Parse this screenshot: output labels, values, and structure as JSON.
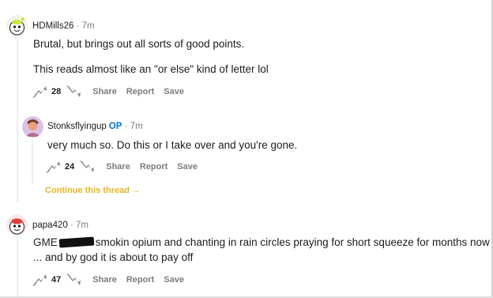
{
  "comments": [
    {
      "author": "HDMills26",
      "op_badge": "",
      "separator": "·",
      "time": "7m",
      "lines": [
        "Brutal, but brings out all sorts of good points.",
        "This reads almost like an \"or else\" kind of letter lol"
      ],
      "score": "28",
      "actions": [
        "Share",
        "Report",
        "Save"
      ]
    },
    {
      "author": "Stonksflyingup",
      "op_badge": "OP",
      "separator": "·",
      "time": "7m",
      "lines": [
        "very much so. Do this or I take over and you're gone."
      ],
      "score": "24",
      "actions": [
        "Share",
        "Report",
        "Save"
      ],
      "continue_link": "Continue this thread →"
    },
    {
      "author": "papa420",
      "op_badge": "",
      "separator": "·",
      "time": "7m",
      "line1_before": "GME",
      "line1_after": "smokin opium and chanting in rain circles praying for short squeeze for months now",
      "line2": "... and by god it is about to pay off",
      "score": "47",
      "actions": [
        "Share",
        "Report",
        "Save"
      ]
    }
  ],
  "colors": {
    "accent": "#0079d3",
    "continue": "#e8b41f",
    "muted": "#7c7c7c"
  }
}
